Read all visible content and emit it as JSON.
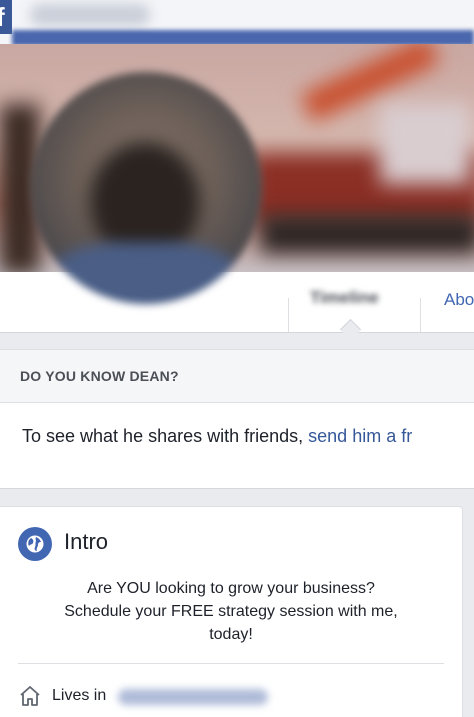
{
  "topbar": {
    "logo_glyph": "f"
  },
  "tabs": {
    "timeline_label": "Timeline",
    "about_label": "Abo"
  },
  "know_card": {
    "title": "DO YOU KNOW DEAN?",
    "body_text": "To see what he shares with friends, ",
    "link_text": "send him a fr"
  },
  "intro": {
    "title": "Intro",
    "bio_lines": [
      "Are YOU looking to grow your business?",
      "Schedule your FREE strategy session with me,",
      "today!"
    ],
    "lives_in_label": "Lives in"
  },
  "colors": {
    "brand_blue": "#3b5998",
    "link_blue": "#365899",
    "background": "#e9ebee"
  },
  "icons": {
    "intro": "globe-icon",
    "lives_in": "home-icon"
  }
}
